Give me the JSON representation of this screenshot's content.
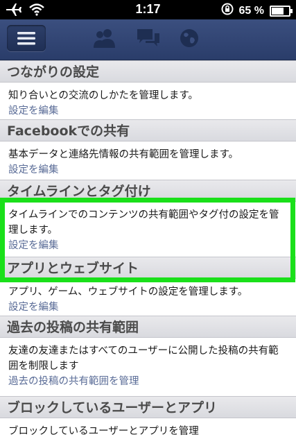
{
  "status": {
    "time": "1:17",
    "battery": "65 %",
    "battery_level": 0.65
  },
  "nav": {
    "icons": [
      "menu-icon",
      "friends-icon",
      "messages-icon",
      "globe-icon"
    ]
  },
  "sections": [
    {
      "title": "つながりの設定",
      "desc": "知り合いとの交流のしかたを管理します。",
      "link": "設定を編集"
    },
    {
      "title": "Facebookでの共有",
      "desc": "基本データと連絡先情報の共有範囲を管理します。",
      "link": "設定を編集"
    },
    {
      "title": "タイムラインとタグ付け",
      "desc": "タイムラインでのコンテンツの共有範囲やタグ付の設定を管理します。",
      "link": "設定を編集"
    },
    {
      "title": "アプリとウェブサイト",
      "desc": "アプリ、ゲーム、ウェブサイトの設定を管理します。",
      "link": "設定を編集"
    },
    {
      "title": "過去の投稿の共有範囲",
      "desc": "友達の友達またはすべてのユーザーに公開した投稿の共有範囲を制限します",
      "link": "過去の投稿の共有範囲を管理"
    },
    {
      "title": "ブロックしているユーザーとアプリ",
      "desc": "ブロックしているユーザーとアプリを管理",
      "link": ""
    }
  ],
  "colors": {
    "highlight": "#1ae01a",
    "navbar": "#3b4f7f",
    "link": "#5a6c97"
  }
}
